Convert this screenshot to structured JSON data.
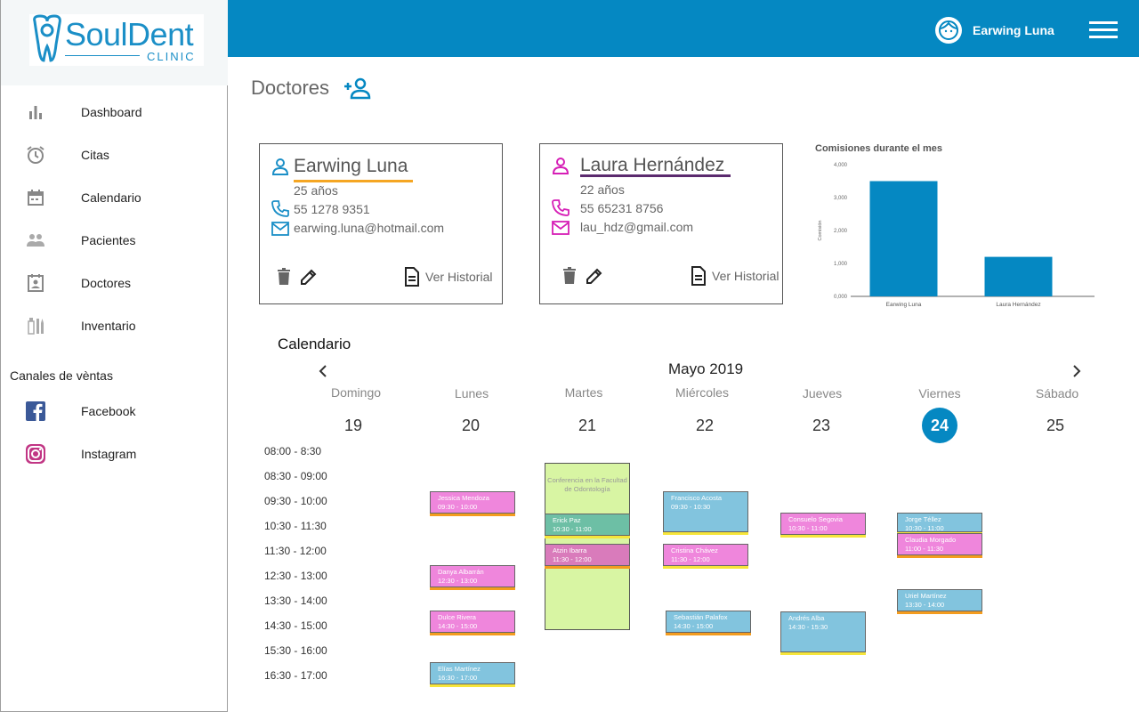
{
  "brand": {
    "name": "SoulDent",
    "sub": "CLINIC"
  },
  "sidebar": {
    "items": [
      {
        "label": "Dashboard",
        "icon": "bar-chart-icon"
      },
      {
        "label": "Citas",
        "icon": "alarm-clock-icon"
      },
      {
        "label": "Calendario",
        "icon": "calendar-icon"
      },
      {
        "label": "Pacientes",
        "icon": "people-icon"
      },
      {
        "label": "Doctores",
        "icon": "doctor-badge-icon"
      },
      {
        "label": "Inventario",
        "icon": "dental-tools-icon"
      }
    ],
    "sales_title": "Canales de vèntas",
    "sales": [
      {
        "label": "Facebook",
        "icon": "facebook-icon"
      },
      {
        "label": "Instagram",
        "icon": "instagram-icon"
      }
    ]
  },
  "header": {
    "user_name": "Earwing Luna"
  },
  "page": {
    "title": "Doctores"
  },
  "doctors": [
    {
      "name": "Earwing Luna",
      "age": "25 años",
      "phone": "55 1278 9351",
      "email": "earwing.luna@hotmail.com",
      "history": "Ver Historial",
      "accent": "#f5a623",
      "icon_color": "#1b8fc7"
    },
    {
      "name": "Laura Hernández",
      "age": "22 años",
      "phone": "55 65231 8756",
      "email": "lau_hdz@gmail.com",
      "history": "Ver Historial",
      "accent": "#5b2a6e",
      "icon_color": "#d61fb6"
    }
  ],
  "chart_data": {
    "type": "bar",
    "title": "Comisiones durante el mes",
    "categories": [
      "Earwing Luna",
      "Laura Hernández"
    ],
    "values": [
      3500,
      1200
    ],
    "ylabel": "Comisión",
    "xlabel": "",
    "ylim": [
      0,
      4000
    ],
    "yticks": [
      "0,000",
      "1,000",
      "2,000",
      "3,000",
      "4,000"
    ],
    "color": "#0588c2"
  },
  "calendar": {
    "title": "Calendario",
    "month": "Mayo 2019",
    "days": [
      {
        "name": "Domingo",
        "num": "19"
      },
      {
        "name": "Lunes",
        "num": "20"
      },
      {
        "name": "Martes",
        "num": "21"
      },
      {
        "name": "Miércoles",
        "num": "22"
      },
      {
        "name": "Jueves",
        "num": "23"
      },
      {
        "name": "Viernes",
        "num": "24"
      },
      {
        "name": "Sábado",
        "num": "25"
      }
    ],
    "today": "24",
    "slots": [
      "08:00 - 8:30",
      "08:30 - 09:00",
      "09:30 - 10:00",
      "10:30 - 11:30",
      "11:30 - 12:00",
      "12:30 - 13:00",
      "13:30 - 14:00",
      "14:30 - 15:00",
      "15:30 - 16:00",
      "16:30 - 17:00"
    ],
    "conference": "Conferencia en la Facultad de Odontología",
    "events": [
      {
        "name": "Jessica Mendoza",
        "time": "09:30 - 10:00"
      },
      {
        "name": "Danya Albarrán",
        "time": "12:30 - 13:00"
      },
      {
        "name": "Dulce Rivera",
        "time": "14:30 - 15:00"
      },
      {
        "name": "Elías Martínez",
        "time": "16:30 - 17:00"
      },
      {
        "name": "Erick Paz",
        "time": "10:30 - 11:00"
      },
      {
        "name": "Atzin Ibarra",
        "time": "11:30 - 12:00"
      },
      {
        "name": "Francisco Acosta",
        "time": "09:30 - 10:30"
      },
      {
        "name": "Cristina Chávez",
        "time": "11:30 - 12:00"
      },
      {
        "name": "Sebastián Palafox",
        "time": "14:30 - 15:00"
      },
      {
        "name": "Consuelo Segovia",
        "time": "10:30 - 11:00"
      },
      {
        "name": "Andrés  Alba",
        "time": "14:30 - 15:30"
      },
      {
        "name": "Jorge Téllez",
        "time": "10:30 - 11:00"
      },
      {
        "name": "Claudia Morgado",
        "time": "11:00 - 11:30"
      },
      {
        "name": "Uriel Martínez",
        "time": "13:30 - 14:00"
      }
    ]
  }
}
